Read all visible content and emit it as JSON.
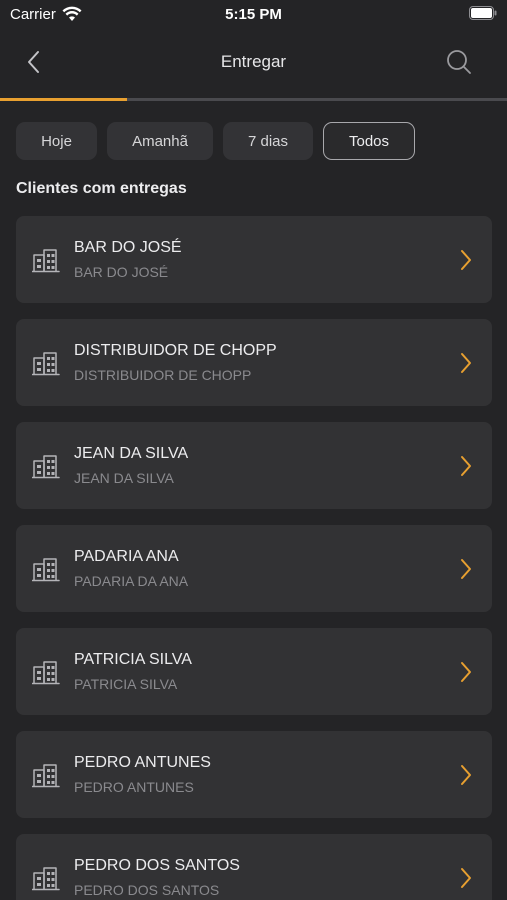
{
  "status": {
    "carrier": "Carrier",
    "time": "5:15 PM"
  },
  "nav": {
    "title": "Entregar"
  },
  "progress": {
    "fraction": 0.25,
    "color": "#e8a030"
  },
  "filters": [
    {
      "label": "Hoje",
      "active": false
    },
    {
      "label": "Amanhã",
      "active": false
    },
    {
      "label": "7 dias",
      "active": false
    },
    {
      "label": "Todos",
      "active": true
    }
  ],
  "section": {
    "title": "Clientes com entregas"
  },
  "accent_color": "#e8a030",
  "clients": [
    {
      "name": "BAR DO JOSÉ",
      "subtitle": "BAR DO JOSÉ",
      "icon": "building-icon"
    },
    {
      "name": "DISTRIBUIDOR DE CHOPP",
      "subtitle": "DISTRIBUIDOR DE CHOPP",
      "icon": "building-icon"
    },
    {
      "name": "JEAN DA SILVA",
      "subtitle": "JEAN DA SILVA",
      "icon": "building-icon"
    },
    {
      "name": "PADARIA ANA",
      "subtitle": "PADARIA DA ANA",
      "icon": "building-icon"
    },
    {
      "name": "PATRICIA SILVA",
      "subtitle": "PATRICIA SILVA",
      "icon": "building-icon"
    },
    {
      "name": "PEDRO ANTUNES",
      "subtitle": "PEDRO ANTUNES",
      "icon": "building-icon"
    },
    {
      "name": "PEDRO DOS SANTOS",
      "subtitle": "PEDRO DOS SANTOS",
      "icon": "building-icon"
    }
  ]
}
